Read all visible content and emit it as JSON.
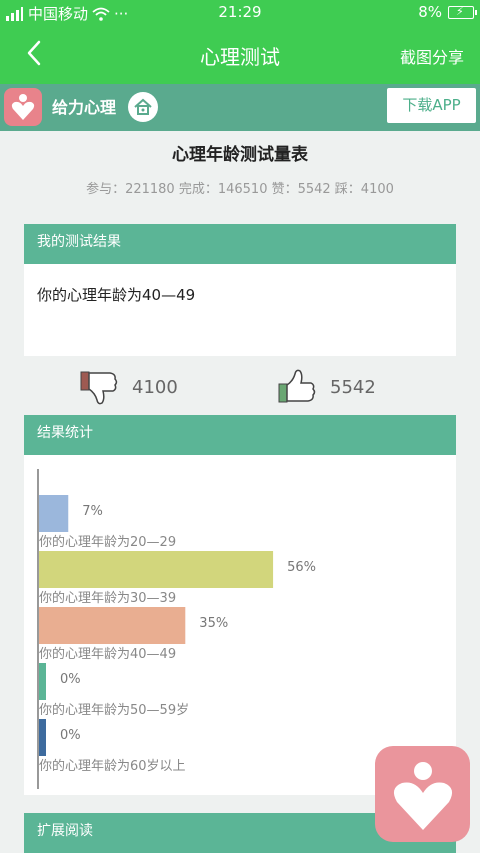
{
  "status_bar": {
    "carrier": "中国移动",
    "more": "···",
    "time": "21:29",
    "battery": "8%"
  },
  "nav": {
    "title": "心理测试",
    "share_label": "截图分享"
  },
  "banner": {
    "app_name": "给力心理",
    "download_label": "下载APP"
  },
  "page": {
    "title": "心理年龄测试量表",
    "stats": "参与：221180 完成：146510 赞：5542 踩：4100"
  },
  "result": {
    "header": "我的测试结果",
    "text": "你的心理年龄为40—49"
  },
  "votes": {
    "dislike_count": "4100",
    "like_count": "5542"
  },
  "stats_section": {
    "header": "结果统计"
  },
  "chart_data": {
    "type": "bar",
    "orientation": "horizontal",
    "categories": [
      "你的心理年龄为20—29",
      "你的心理年龄为30—39",
      "你的心理年龄为40—49",
      "你的心理年龄为50—59岁",
      "你的心理年龄为60岁以上"
    ],
    "values": [
      7,
      56,
      35,
      0,
      0
    ],
    "value_labels": [
      "7%",
      "56%",
      "35%",
      "0%",
      "0%"
    ],
    "colors": [
      "#9bb7dc",
      "#d2d67c",
      "#e9ae91",
      "#5bb596",
      "#3d6b9e"
    ],
    "unit": "%"
  },
  "extended_reading": {
    "header": "扩展阅读"
  },
  "colors": {
    "primary_green": "#3fcc52",
    "teal": "#5bb596",
    "brand_pink": "#e8838b"
  }
}
